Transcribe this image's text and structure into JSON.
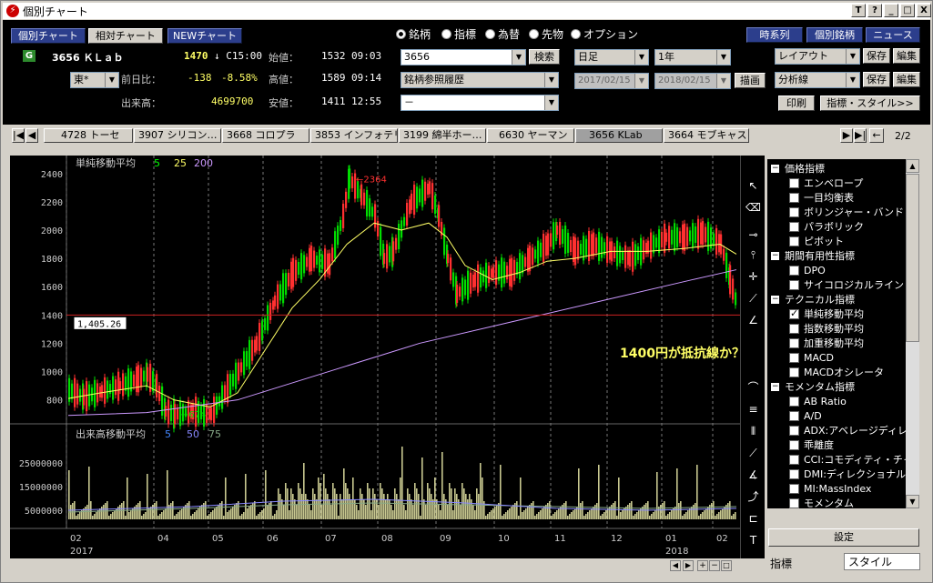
{
  "window": {
    "title": "個別チャート",
    "buttons": [
      "T",
      "?",
      "_",
      "□",
      "X"
    ]
  },
  "modes": {
    "individual": "個別チャート",
    "relative": "相対チャート",
    "new": "NEWチャート"
  },
  "quote": {
    "market_badge": "G",
    "code_name": "3656 ＫＬａｂ",
    "price": "1470",
    "arrow_time": "↓ C15:00",
    "prev_label": "前日比：",
    "change": "-138",
    "change_pct": "-8.58%",
    "volume_label": "出来高：",
    "volume": "4699700",
    "open_label": "始値：",
    "open": "1532",
    "open_time": "09:03",
    "high_label": "高値：",
    "high": "1589",
    "high_time": "09:14",
    "low_label": "安値：",
    "low": "1411",
    "low_time": "12:55",
    "exchange": "東*"
  },
  "asset_types": [
    "銘柄",
    "指標",
    "為替",
    "先物",
    "オプション"
  ],
  "search": {
    "code": "3656",
    "search_button": "検索",
    "history": "銘柄参照履歴",
    "blank": "－"
  },
  "period": {
    "interval": "日足",
    "range": "1年",
    "from": "2017/02/15",
    "to": "2018/02/15",
    "draw": "描画"
  },
  "right_buttons": {
    "timeseries": "時系列",
    "stock_info": "個別銘柄",
    "news": "ニュース",
    "layout": "レイアウト",
    "save": "保存",
    "edit": "編集",
    "analysis": "分析線",
    "print": "印刷",
    "indicator_style": "指標・スタイル>>"
  },
  "stock_tabs": [
    "4728 トーセ",
    "3907 シリコン…",
    "3668 コロプラ",
    "3853 インフォテリ",
    "3199 綿半ホー…",
    "6630 ヤーマン",
    "3656 KLab",
    "3664 モブキャス"
  ],
  "page": "2/2",
  "chart_labels": {
    "sma": "単純移動平均",
    "sma_p": [
      "5",
      "25",
      "200"
    ],
    "vma": "出来高移動平均",
    "vma_p": [
      "5",
      "50",
      "75"
    ],
    "high_mark": "2364",
    "low_mark": "674",
    "cursor_value": "1,405.26",
    "annotation": "1400円が抵抗線か？"
  },
  "chart_data": {
    "type": "line",
    "yticks": [
      2400,
      2200,
      2000,
      1800,
      1600,
      1400,
      1200,
      1000,
      800
    ],
    "vticks": [
      "25000000",
      "15000000",
      "5000000"
    ],
    "xticks": [
      "02",
      "04",
      "05",
      "06",
      "07",
      "08",
      "09",
      "10",
      "11",
      "12",
      "01",
      "02"
    ],
    "years": [
      "2017",
      "2018"
    ],
    "resistance": 1400
  },
  "tree": {
    "groups": [
      {
        "label": "価格指標",
        "items": [
          "エンベロープ",
          "一目均衡表",
          "ボリンジャー・バンド",
          "パラボリック",
          "ピボット"
        ]
      },
      {
        "label": "期間有用性指標",
        "items": [
          "DPO",
          "サイコロジカルライン"
        ]
      },
      {
        "label": "テクニカル指標",
        "items": [
          "単純移動平均",
          "指数移動平均",
          "加重移動平均",
          "MACD",
          "MACDオシレータ"
        ]
      },
      {
        "label": "モメンタム指標",
        "items": [
          "AB Ratio",
          "A/D",
          "ADX:アベレージディレ",
          "乖離度",
          "CCI:コモディティ・チャ",
          "DMI:ディレクショナル",
          "MI:MassIndex",
          "モメンタム"
        ]
      }
    ]
  },
  "bottom": {
    "settings": "設定",
    "tab_indicator": "指標",
    "tab_style": "スタイル"
  }
}
